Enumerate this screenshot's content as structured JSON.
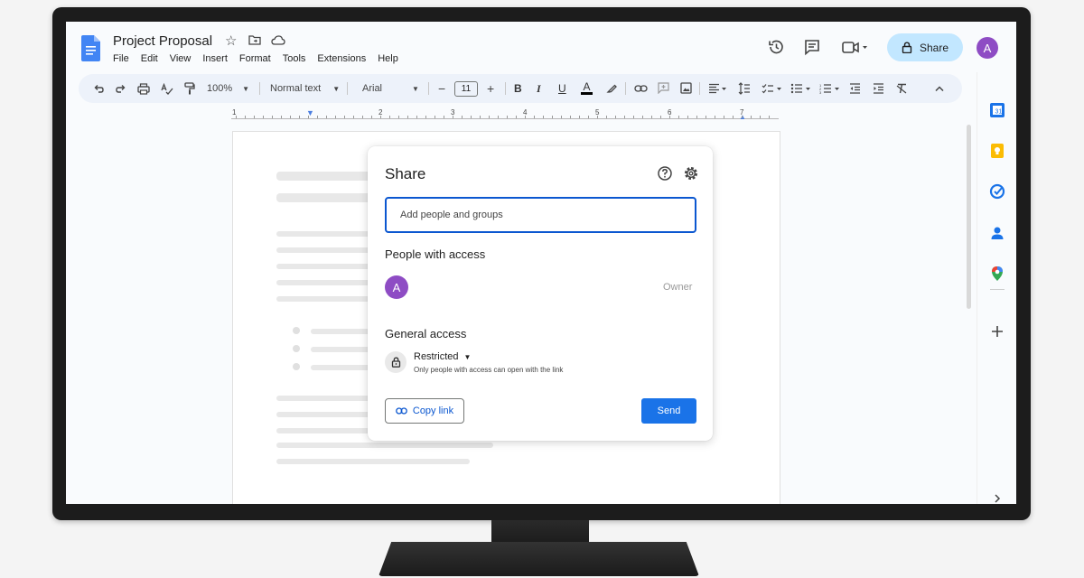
{
  "header": {
    "title": "Project Proposal",
    "menu": [
      "File",
      "Edit",
      "View",
      "Insert",
      "Format",
      "Tools",
      "Extensions",
      "Help"
    ],
    "share_label": "Share",
    "avatar_initial": "A"
  },
  "toolbar": {
    "zoom": "100%",
    "style": "Normal text",
    "font": "Arial",
    "font_size": "11"
  },
  "ruler": {
    "numbers": [
      "1",
      "1",
      "2",
      "3",
      "4",
      "5",
      "6",
      "7"
    ]
  },
  "share_dialog": {
    "title": "Share",
    "input_placeholder": "Add people and groups",
    "people_heading": "People with access",
    "person_initial": "A",
    "person_role": "Owner",
    "general_heading": "General access",
    "access_level": "Restricted",
    "access_description": "Only people with access can open with the link",
    "copy_link_label": "Copy link",
    "send_label": "Send"
  },
  "colors": {
    "accent": "#1a73e8",
    "share_bg": "#c2e7ff",
    "avatar": "#8e4cc4"
  }
}
